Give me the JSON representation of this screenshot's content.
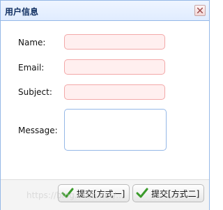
{
  "window": {
    "title": "用户信息"
  },
  "form": {
    "fields": [
      {
        "label": "Name:",
        "value": ""
      },
      {
        "label": "Email:",
        "value": ""
      },
      {
        "label": "Subject:",
        "value": ""
      }
    ],
    "message_label": "Message:",
    "message_value": ""
  },
  "footer": {
    "submit1_label": "提交[方式一]",
    "submit2_label": "提交[方式二]"
  },
  "watermark": "https://blog.csdn.net/..."
}
